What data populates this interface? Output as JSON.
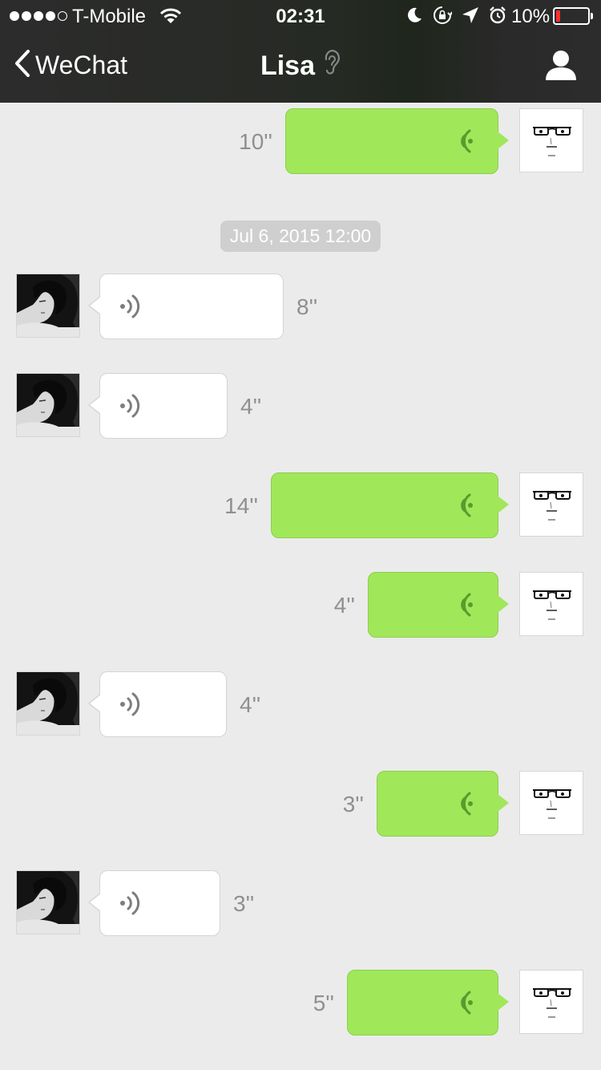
{
  "status_bar": {
    "carrier": "T-Mobile",
    "time": "02:31",
    "battery": "10%",
    "signal_bars_filled": 4,
    "signal_bars_total": 5,
    "icons": [
      "wifi-icon",
      "moon-icon",
      "rotation-lock-icon",
      "location-arrow-icon",
      "alarm-icon",
      "battery-icon"
    ]
  },
  "nav": {
    "back_label": "WeChat",
    "title": "Lisa",
    "title_icon": "ear-icon",
    "right_icon": "profile-icon"
  },
  "chat": {
    "timestamp": "Jul 6, 2015 12:00",
    "messages": [
      {
        "from": "me",
        "type": "voice",
        "duration": "10''"
      },
      {
        "from": "her",
        "type": "voice",
        "duration": "8''"
      },
      {
        "from": "her",
        "type": "voice",
        "duration": "4''"
      },
      {
        "from": "me",
        "type": "voice",
        "duration": "14''"
      },
      {
        "from": "me",
        "type": "voice",
        "duration": "4''"
      },
      {
        "from": "her",
        "type": "voice",
        "duration": "4''"
      },
      {
        "from": "me",
        "type": "voice",
        "duration": "3''"
      },
      {
        "from": "her",
        "type": "voice",
        "duration": "3''"
      },
      {
        "from": "me",
        "type": "voice",
        "duration": "5''"
      }
    ]
  },
  "colors": {
    "nav_bg": "#2c2c2c",
    "outgoing_bubble": "#a0e75a",
    "incoming_bubble": "#ffffff",
    "chat_bg": "#ebebeb",
    "battery_low": "#ff2d2d"
  }
}
